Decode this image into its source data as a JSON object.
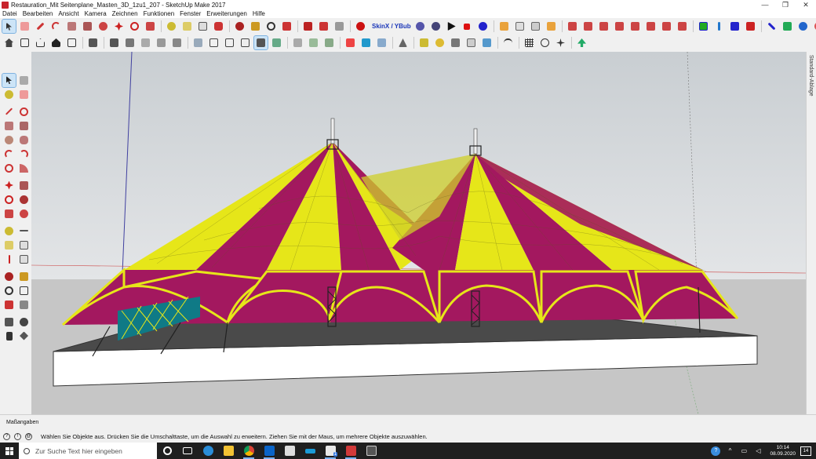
{
  "window": {
    "title": "Restauration_Mit Seitenplane_Masten_3D_1zu1_207 - SketchUp Make 2017",
    "controls": [
      "—",
      "❐",
      "✕"
    ]
  },
  "menu": [
    "Datei",
    "Bearbeiten",
    "Ansicht",
    "Kamera",
    "Zeichnen",
    "Funktionen",
    "Fenster",
    "Erweiterungen",
    "Hilfe"
  ],
  "toolbar": {
    "skinx_label": "SkinX / YBub"
  },
  "tray_tab_label": "Standard-Ablage",
  "vcb": {
    "label": "Maßangaben"
  },
  "status": {
    "icons": [
      "?",
      "!",
      "@"
    ],
    "message": "Wählen Sie Objekte aus. Drücken Sie die Umschalttaste, um die Auswahl zu erweitern. Ziehen Sie mit der Maus, um mehrere Objekte auszuwählen."
  },
  "taskbar": {
    "search_placeholder": "Zur Suche Text hier eingeben",
    "badge": "1",
    "time": "10:14",
    "date": "08.09.2020",
    "notifications": "14"
  },
  "colors": {
    "tent_magenta": "#a3185f",
    "tent_yellow": "#e6e619",
    "ground": "#c8c8c8",
    "sky": "#dde0e3",
    "platform_top": "#4a4a4a"
  }
}
